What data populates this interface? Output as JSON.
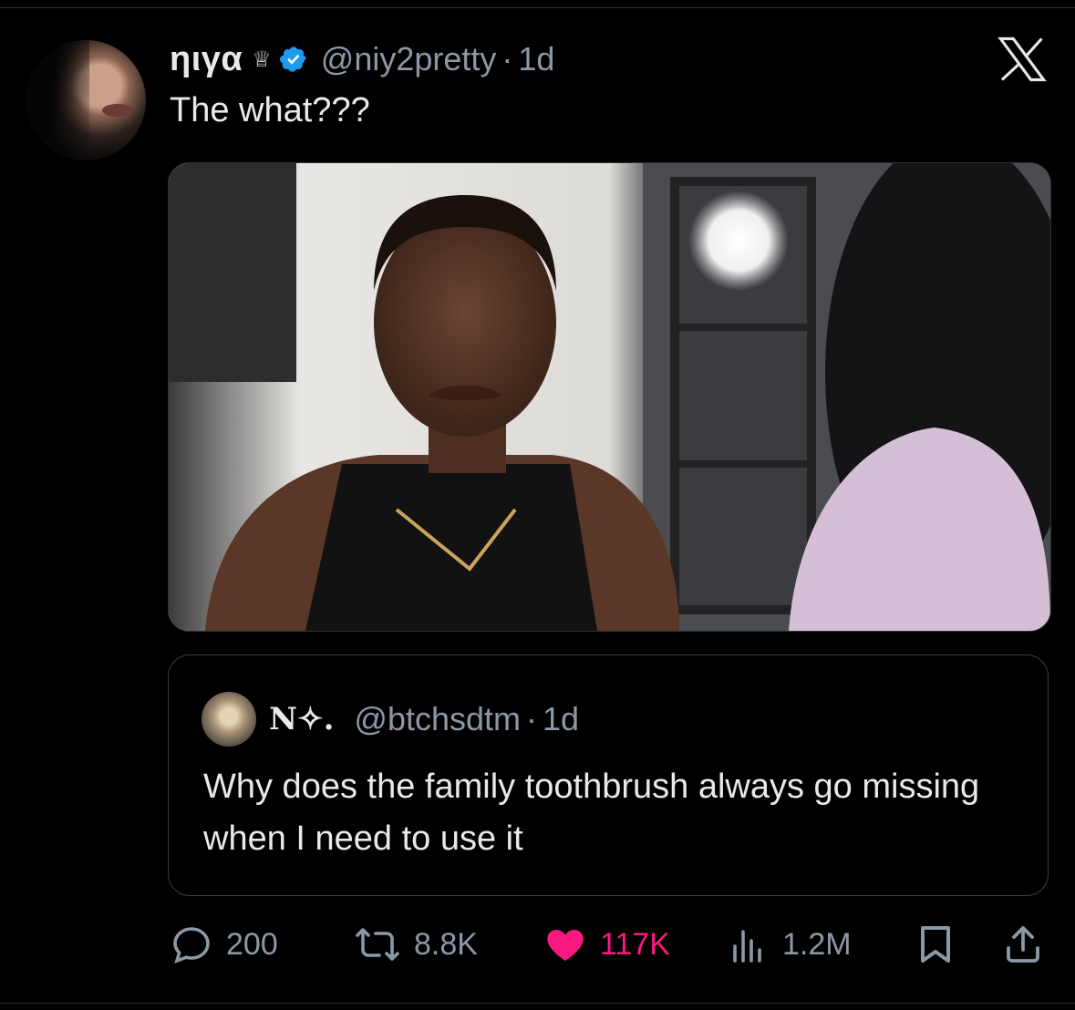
{
  "author": {
    "display_name": "ηιγα",
    "crown_glyph": "♕",
    "verified": true,
    "handle": "@niy2pretty",
    "separator": "·",
    "time": "1d",
    "avatar_icon": "profile-photo"
  },
  "tweet": {
    "text": "The what???"
  },
  "media": {
    "description_icon": "reaction-photo"
  },
  "quoted": {
    "display_name": "N✧.",
    "handle": "@btchsdtm",
    "separator": "·",
    "time": "1d",
    "text": "Why does the family toothbrush always go missing when I need to use it"
  },
  "actions": {
    "replies": "200",
    "reposts": "8.8K",
    "likes": "117K",
    "views": "1.2M"
  },
  "colors": {
    "background": "#000000",
    "text": "#e7e9ea",
    "muted": "#8b98a5",
    "like": "#f91880",
    "verified": "#1d9bf0"
  }
}
